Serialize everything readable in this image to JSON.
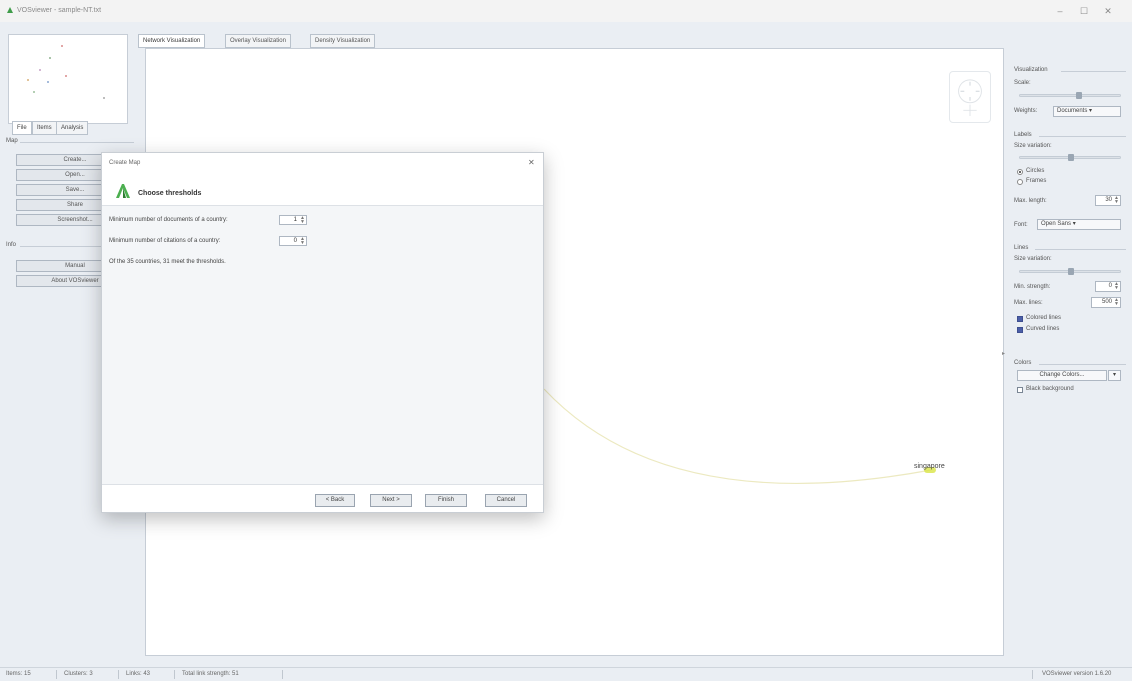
{
  "window": {
    "title": "VOSviewer - sample-NT.txt",
    "minimize": "–",
    "maximize": "☐",
    "close": "✕"
  },
  "left_panel": {
    "tabs": [
      "File",
      "Items",
      "Analysis"
    ],
    "map_group": "Map",
    "map_buttons": [
      "Create...",
      "Open...",
      "Save...",
      "Share",
      "Screenshot..."
    ],
    "info_group": "Info",
    "info_buttons": [
      "Manual",
      "About VOSviewer"
    ]
  },
  "view_tabs": [
    "Network Visualization",
    "Overlay Visualization",
    "Density Visualization"
  ],
  "canvas": {
    "node_label": "singapore"
  },
  "right_panel": {
    "visualization_title": "Visualization",
    "scale_label": "Scale:",
    "weights_label": "Weights:",
    "weights_value": "Documents",
    "labels_title": "Labels",
    "size_variation_label": "Size variation:",
    "circles": "Circles",
    "frames": "Frames",
    "max_length_label": "Max. length:",
    "max_length_value": "30",
    "font_label": "Font:",
    "font_value": "Open Sans",
    "lines_title": "Lines",
    "lines_size_variation_label": "Size variation:",
    "min_strength_label": "Min. strength:",
    "min_strength_value": "0",
    "max_lines_label": "Max. lines:",
    "max_lines_value": "500",
    "colored_lines": "Colored lines",
    "curved_lines": "Curved lines",
    "colors_title": "Colors",
    "change_colors": "Change Colors...",
    "black_background": "Black background",
    "expand_arrow": "▸"
  },
  "status_bar": {
    "items": "Items: 15",
    "clusters": "Clusters: 3",
    "links": "Links: 43",
    "total_link_strength": "Total link strength: 51",
    "version": "VOSviewer version 1.6.20"
  },
  "dialog": {
    "title": "Create Map",
    "close": "✕",
    "heading": "Choose thresholds",
    "min_documents_label": "Minimum number of documents of a country:",
    "min_documents_value": "1",
    "min_citations_label": "Minimum number of citations of a country:",
    "min_citations_value": "0",
    "note": "Of the 35 countries, 31 meet the thresholds.",
    "buttons": {
      "back": "< Back",
      "next": "Next >",
      "finish": "Finish",
      "cancel": "Cancel"
    }
  },
  "colors": {
    "accent_green": "#4caf50",
    "node_yellow": "#d7e33a",
    "checkbox_blue": "#4b5ea8"
  }
}
